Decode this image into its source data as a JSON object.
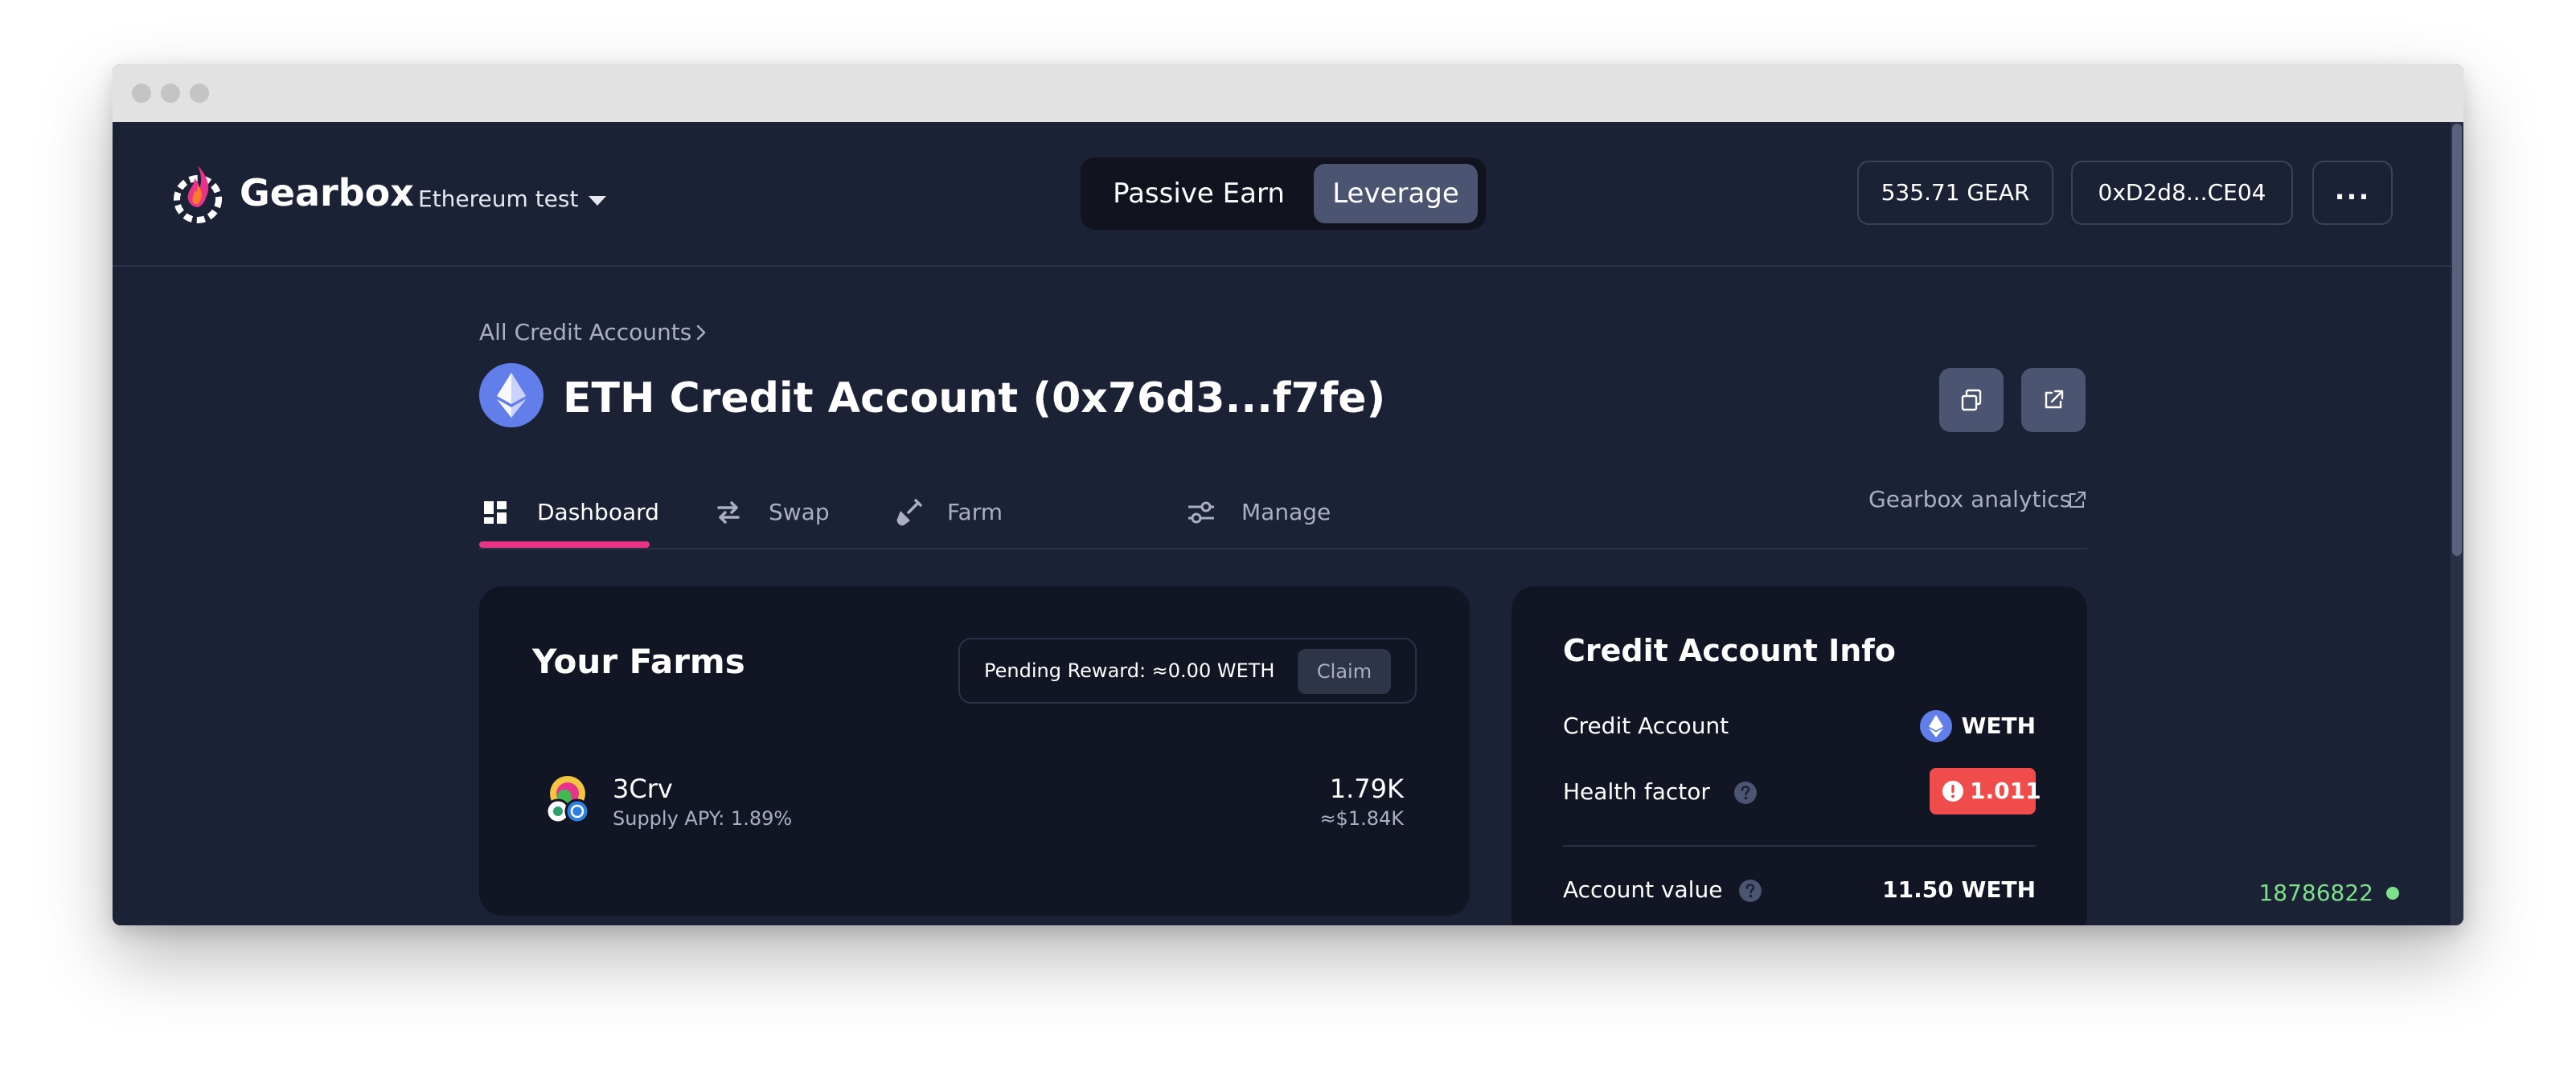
{
  "header": {
    "brand": "Gearbox",
    "network": "Ethereum test",
    "mode_toggle": {
      "passive": "Passive Earn",
      "leverage": "Leverage",
      "selected": "Leverage"
    },
    "gear_balance": "535.71 GEAR",
    "wallet_address": "0xD2d8...CE04",
    "more_label": "..."
  },
  "breadcrumb": {
    "parent": "All Credit Accounts"
  },
  "page": {
    "title": "ETH Credit Account (0x76d3...f7fe)"
  },
  "tabs": [
    {
      "label": "Dashboard",
      "icon": "dashboard-icon",
      "active": true
    },
    {
      "label": "Swap",
      "icon": "swap-icon",
      "active": false
    },
    {
      "label": "Farm",
      "icon": "farm-shovel-icon",
      "active": false
    },
    {
      "label": "Manage",
      "icon": "sliders-icon",
      "active": false
    }
  ],
  "analytics_link": "Gearbox analytics",
  "farms": {
    "title": "Your Farms",
    "pending_reward": "Pending Reward: ≈0.00 WETH",
    "claim_label": "Claim",
    "items": [
      {
        "name": "3Crv",
        "apy": "Supply APY: 1.89%",
        "amount": "1.79K",
        "usd": "≈$1.84K"
      }
    ]
  },
  "credit_info": {
    "title": "Credit Account Info",
    "credit_account_label": "Credit Account",
    "credit_account_asset": "WETH",
    "health_factor_label": "Health factor",
    "health_factor_value": "1.011",
    "account_value_label": "Account value",
    "account_value": "11.50 WETH"
  },
  "status": {
    "block_number": "18786822"
  },
  "colors": {
    "background": "#1c2236",
    "card": "#111524",
    "accent_tab": "#e8338a",
    "health_danger": "#f04c4c",
    "block_ok": "#7ee08a"
  }
}
